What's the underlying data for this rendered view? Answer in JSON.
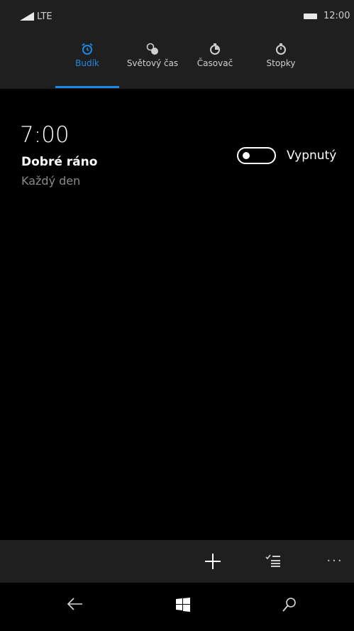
{
  "status_bar": {
    "network": "LTE",
    "time": "12:00",
    "icons": [
      "signal-icon",
      "battery-icon"
    ]
  },
  "tabs": [
    {
      "label": "Budík",
      "icon": "alarm-clock-icon",
      "active": true
    },
    {
      "label": "Světový čas",
      "icon": "world-clock-icon",
      "active": false
    },
    {
      "label": "Časovač",
      "icon": "timer-icon",
      "active": false
    },
    {
      "label": "Stopky",
      "icon": "stopwatch-icon",
      "active": false
    }
  ],
  "alarm": {
    "time": "7:00",
    "name": "Dobré ráno",
    "repeat": "Každý den",
    "state_label": "Vypnutý",
    "enabled": false
  },
  "app_bar": {
    "buttons": [
      "add-icon",
      "select-list-icon",
      "more-icon"
    ],
    "more_label": "..."
  },
  "nav_bar": {
    "buttons": [
      "back-arrow-icon",
      "windows-logo-icon",
      "search-icon"
    ]
  },
  "colors": {
    "accent": "#1e88e5",
    "background": "#000000",
    "bar": "#1f1f1f",
    "secondary_text": "#8a8a8a"
  }
}
